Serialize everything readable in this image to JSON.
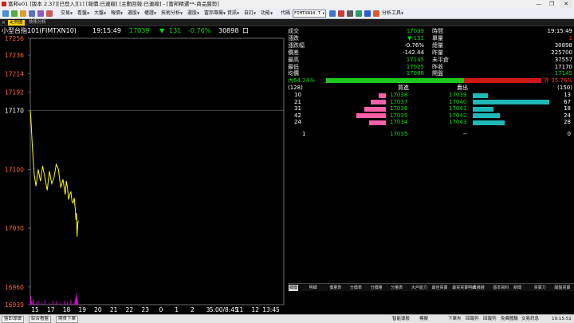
{
  "window": {
    "title": "富邦e01 [版本 2.37][已登入][1] [報價:已連線] [主動回報:已連線] - [富邦精選**-商品盤勢]",
    "minimize": "—",
    "restore": "❐",
    "close": "✕"
  },
  "menu": {
    "items": [
      "交易",
      "看盤",
      "大盤",
      "報價",
      "選股",
      "權證",
      "技術分析",
      "選股",
      "富邦專屬",
      "資訊",
      "自訂",
      "功能"
    ],
    "symbol_label": "代碼",
    "symbol_value": "FIMTXN10.T",
    "analysis_tools": "分析工具"
  },
  "tabs": {
    "close": "×",
    "active": "走勢圖",
    "second": "技術分析"
  },
  "chart_header": {
    "name": "小型台指101(FIMTXN10)",
    "time": "19:15:49",
    "price": "17039",
    "arrow": "▼",
    "change": "131",
    "percent": "-0.76%",
    "volume": "30898",
    "unit": "口"
  },
  "chart_data": {
    "type": "line",
    "series": [
      {
        "kind": "price",
        "color": "#ffff00",
        "x": [
          15,
          15.06,
          15.18,
          15.35,
          15.5,
          15.7,
          15.9,
          16.1,
          16.3,
          16.5,
          16.7,
          16.9,
          17.1,
          17.3,
          17.5,
          17.7,
          17.9,
          18.1,
          18.2,
          18.3,
          18.4,
          18.5,
          18.6,
          18.7,
          18.8,
          18.9,
          19.0,
          19.05,
          19.1,
          19.15,
          19.22,
          19.26
        ],
        "y": [
          17170,
          17160,
          17128,
          17094,
          17080,
          17100,
          17086,
          17104,
          17090,
          17075,
          17098,
          17083,
          17090,
          17106,
          17100,
          17078,
          17088,
          17070,
          17086,
          17078,
          17064,
          17070,
          17073,
          17062,
          17060,
          17066,
          17052,
          17040,
          17048,
          17020,
          17036,
          17039
        ]
      }
    ],
    "volume": {
      "color": "#e000e0",
      "x": [
        15,
        15.05,
        15.1,
        15.2,
        15.3,
        15.5,
        15.7,
        16,
        16.3,
        16.7,
        17,
        17.3,
        17.7,
        18,
        18.3,
        18.6,
        18.9,
        19.0,
        19.05,
        19.1,
        19.15,
        19.2
      ],
      "v": [
        5,
        9,
        4,
        3,
        6,
        2,
        4,
        3,
        5,
        2,
        4,
        3,
        2,
        4,
        3,
        5,
        3,
        6,
        9,
        12,
        7,
        4
      ]
    },
    "xlim": [
      15,
      37.5
    ],
    "ylim": [
      16939,
      17256
    ],
    "reference": 17170,
    "y_ticks": [
      17256,
      17236,
      17214,
      17192,
      17170,
      17100,
      17030,
      16960,
      16939
    ],
    "x_tick_labels": [
      "15",
      "17",
      "18",
      "19",
      "20",
      "21",
      "22",
      "23",
      "0",
      "1",
      "2",
      "3",
      "5:00/8:45",
      "11",
      "12",
      "13:45"
    ]
  },
  "quote": {
    "left": [
      {
        "label": "成交",
        "value": "17039",
        "color": "#00e000"
      },
      {
        "label": "漲跌",
        "value": "▼ 131",
        "color": "#00e000"
      },
      {
        "label": "漲跌幅",
        "value": "-0.76%",
        "color": "#ffffff"
      },
      {
        "label": "價差",
        "value": "-142.44",
        "color": "#ffffff"
      },
      {
        "label": "最高",
        "value": "17145",
        "color": "#00e000"
      },
      {
        "label": "最低",
        "value": "17025",
        "color": "#00e000"
      },
      {
        "label": "均價",
        "value": "17088",
        "color": "#00e000"
      }
    ],
    "right": [
      {
        "label": "時間",
        "value": "19:15:49",
        "color": "#ffffff"
      },
      {
        "label": "單量",
        "value": "1",
        "color": "#ff3030"
      },
      {
        "label": "總量",
        "value": "30898",
        "color": "#ffffff"
      },
      {
        "label": "昨量",
        "value": "225700",
        "color": "#ffffff"
      },
      {
        "label": "未平倉",
        "value": "37557",
        "color": "#ffffff"
      },
      {
        "label": "昨收",
        "value": "17170",
        "color": "#ffffff"
      },
      {
        "label": "開盤",
        "value": "17145",
        "color": "#00e000"
      }
    ]
  },
  "ratio": {
    "inner_label": "內64.24%",
    "outer_label": "外 35.76%",
    "inner_fraction": 0.6424
  },
  "depth": {
    "bid_header": "買進",
    "ask_header": "賣出",
    "bid_total": "(128)",
    "ask_total": "(150)",
    "rows": [
      {
        "bid_qty": "10",
        "bid_price": "17038",
        "ask_price": "17039",
        "ask_qty": "13",
        "bid_v": 10,
        "ask_v": 13
      },
      {
        "bid_qty": "21",
        "bid_price": "17037",
        "ask_price": "17040",
        "ask_qty": "67",
        "bid_v": 21,
        "ask_v": 67
      },
      {
        "bid_qty": "31",
        "bid_price": "17036",
        "ask_price": "17041",
        "ask_qty": "18",
        "bid_v": 31,
        "ask_v": 18
      },
      {
        "bid_qty": "42",
        "bid_price": "17035",
        "ask_price": "17042",
        "ask_qty": "24",
        "bid_v": 42,
        "ask_v": 24
      },
      {
        "bid_qty": "24",
        "bid_price": "17034",
        "ask_price": "17043",
        "ask_qty": "28",
        "bid_v": 24,
        "ask_v": 28
      }
    ],
    "max_v": 70,
    "last_row": {
      "qty": "1",
      "price": "17035",
      "dash": "--",
      "zero": "0"
    }
  },
  "bottom_tabs": [
    "細價",
    "明細",
    "價量表",
    "分價表",
    "分價量",
    "分量表",
    "大戶能力",
    "最佳買賣",
    "最買買賣明細",
    "大錢錢",
    "基本資料",
    "新聞",
    "買賣力",
    "開盤買賣"
  ],
  "status": {
    "tabs": [
      "盤即導讀",
      "綜合看盤",
      "期貨下單"
    ],
    "right": [
      "智能導股",
      "模擬",
      "下單夾",
      "回報列",
      "回報列",
      "免費體驗",
      "交易訊息"
    ],
    "time": "19:15:51"
  }
}
